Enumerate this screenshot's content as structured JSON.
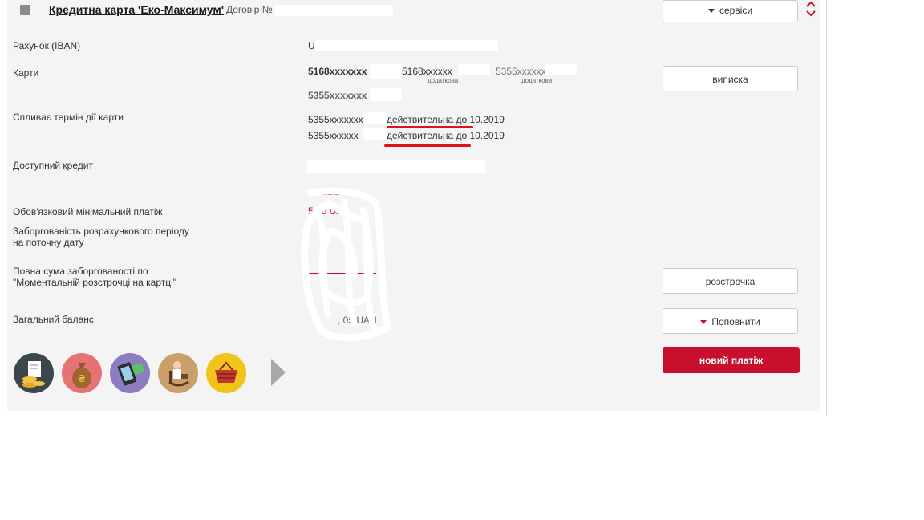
{
  "header": {
    "title": "Кредитна карта 'Еко-Максимум'",
    "contract_label": "Договір №"
  },
  "fields": {
    "iban": {
      "label": "Рахунок (IBAN)",
      "value": "UA"
    },
    "cards": {
      "label": "Карти",
      "list": [
        {
          "number": "5168xxxxxxx",
          "sub": ""
        },
        {
          "number": "5168xxxxxx",
          "sub": "додаткова"
        },
        {
          "number": "5355xxxxxx",
          "sub": "додаткова"
        },
        {
          "number": "5355xxxxxxx",
          "sub": ""
        }
      ]
    },
    "expiry": {
      "label": "Спливає термін дії карти",
      "rows": [
        {
          "card": "5355xxxxxxx",
          "text": "действительна до 10.2019"
        },
        {
          "card": "5355xxxxxx",
          "text": "действительна до 10.2019"
        }
      ]
    },
    "credit": {
      "label": "Доступний кредит"
    },
    "min_payment": {
      "label": "Обов'язковий мінімальний платіж",
      "date_fragment": "22.10.20",
      "value_fragment": "5 . 0 UA"
    },
    "debt_period": {
      "label_line1": "Заборгованість розрахункового періоду",
      "label_line2": "на поточну дату"
    },
    "installment_debt": {
      "label_line1": "Повна сума заборгованості по",
      "label_line2": "\"Моментальній розстрочці на картці\""
    },
    "balance": {
      "label": "Загальний баланс",
      "value_fragment": ", 05 UAH"
    }
  },
  "buttons": {
    "services": "сервіси",
    "statement": "виписка",
    "installment": "розстрочка",
    "topup": "Поповнити",
    "new_payment": "новий платіж"
  },
  "icons": [
    {
      "name": "coins-receipt-icon",
      "color": "#3b464d"
    },
    {
      "name": "money-bag-icon",
      "color": "#e57373"
    },
    {
      "name": "phone-cash-icon",
      "color": "#8e7cc3"
    },
    {
      "name": "pensioner-rocking-chair-icon",
      "color": "#c9a06b"
    },
    {
      "name": "shopping-basket-icon",
      "color": "#f0c419"
    }
  ],
  "colors": {
    "accent": "#c8102e",
    "background": "#f4f4f4",
    "highlight": "#e01020"
  }
}
